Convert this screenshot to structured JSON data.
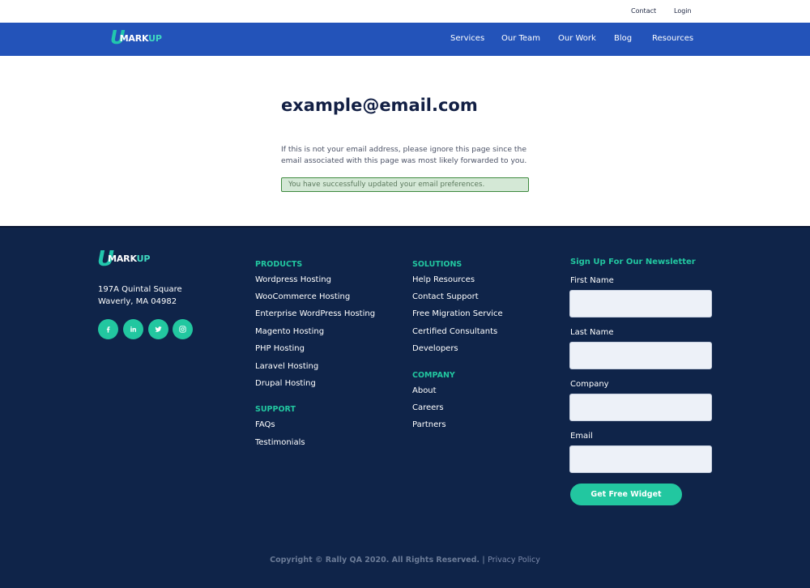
{
  "utility_nav": {
    "contact": "Contact",
    "login": "Login"
  },
  "brand": {
    "letter": "U",
    "word_main": "MARK",
    "word_accent": "UP"
  },
  "main_nav": [
    {
      "label": "Services"
    },
    {
      "label": "Our Team"
    },
    {
      "label": "Our Work"
    },
    {
      "label": "Blog"
    },
    {
      "label": "Resources"
    }
  ],
  "content": {
    "email": "example@email.com",
    "notice": "If this is not your email address, please ignore this page since the email associated with this page was most likely forwarded to you.",
    "success_message": "You have successfully updated your email preferences."
  },
  "footer": {
    "address_line1": "197A Quintal Square",
    "address_line2": "Waverly, MA 04982",
    "social": [
      {
        "icon": "facebook-icon"
      },
      {
        "icon": "linkedin-icon"
      },
      {
        "icon": "twitter-icon"
      },
      {
        "icon": "instagram-icon"
      }
    ],
    "products_heading": "PRODUCTS",
    "products": [
      "Wordpress Hosting",
      "WooCommerce Hosting",
      "Enterprise WordPress Hosting",
      "Magento Hosting",
      "PHP Hosting",
      "Laravel Hosting",
      "Drupal Hosting"
    ],
    "support_heading": "SUPPORT",
    "support": [
      "FAQs",
      "Testimonials"
    ],
    "solutions_heading": "SOLUTIONS",
    "solutions": [
      "Help Resources",
      "Contact Support",
      "Free Migration Service",
      "Certified Consultants",
      "Developers"
    ],
    "company_heading": "COMPANY",
    "company": [
      "About",
      "Careers",
      "Partners"
    ],
    "newsletter": {
      "heading": "Sign Up For Our Newsletter",
      "first_name_label": "First Name",
      "first_name_value": "",
      "last_name_label": "Last Name",
      "last_name_value": "",
      "company_label": "Company",
      "company_value": "",
      "email_label": "Email",
      "email_value": "",
      "button": "Get Free Widget"
    },
    "copyright": "Copyright © Rally QA 2020. All Rights Reserved. |",
    "privacy_policy": "Privacy Policy"
  },
  "colors": {
    "nav_blue": "#2353b9",
    "footer_navy": "#0f2449",
    "accent_teal": "#22c7a0",
    "success_bg": "#d4e8d6",
    "success_border": "#3e8a3e"
  }
}
